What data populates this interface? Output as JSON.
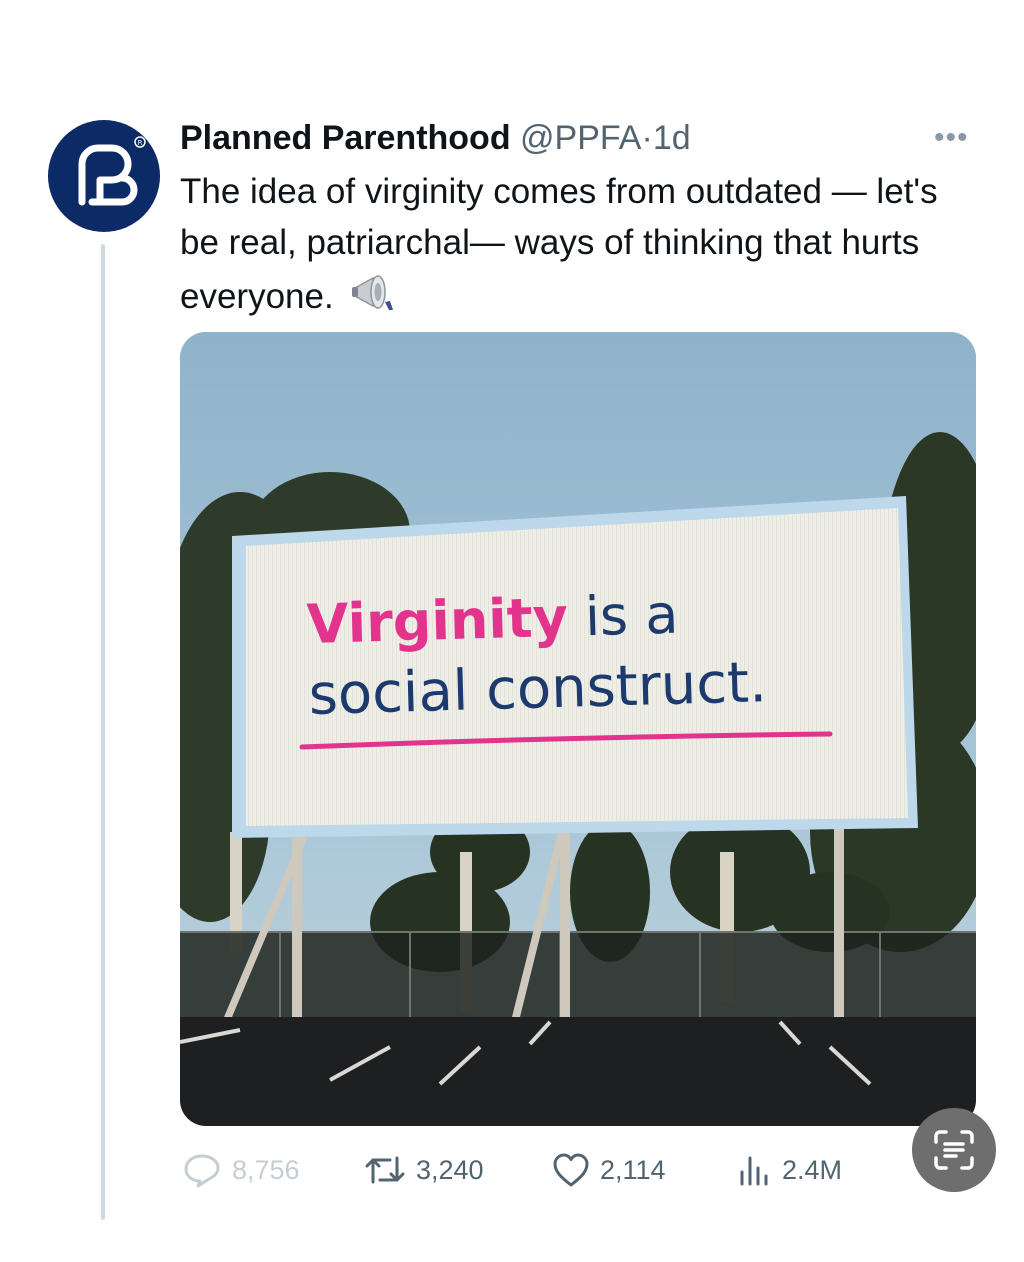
{
  "tweet": {
    "author_name": "Planned Parenthood",
    "author_handle": "@PPFA",
    "separator": "·",
    "time": "1d",
    "more_label": "•••",
    "text": "The idea of virginity comes from outdated — let's be real, patriarchal— ways of thinking that hurts everyone.",
    "emoji": "megaphone-emoji"
  },
  "media": {
    "billboard": {
      "word_highlight": "Virginity",
      "line1_rest": " is a",
      "line2": "social construct."
    },
    "colors": {
      "pink": "#e2348c",
      "navy": "#1d3a6e",
      "sky": "#9dbdd2"
    }
  },
  "actions": {
    "replies": "8,756",
    "retweets": "3,240",
    "likes": "2,114",
    "views": "2.4M"
  },
  "icons": [
    "pp-logo-icon",
    "more-icon",
    "reply-icon",
    "retweet-icon",
    "like-icon",
    "views-icon",
    "text-scan-icon"
  ],
  "accent": "#0c2a66"
}
